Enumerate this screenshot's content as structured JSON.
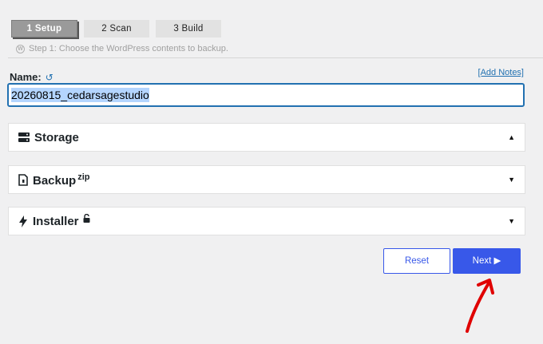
{
  "steps": [
    {
      "label": "1 Setup",
      "active": true
    },
    {
      "label": "2 Scan",
      "active": false
    },
    {
      "label": "3 Build",
      "active": false
    }
  ],
  "step_caption": "Step 1: Choose the WordPress contents to backup.",
  "name": {
    "label": "Name:",
    "add_notes": "[Add Notes]",
    "value": "20260815_cedarsagestudio"
  },
  "panels": {
    "storage": {
      "title": "Storage",
      "icon": "storage-icon",
      "state": "expanded"
    },
    "backup": {
      "title": "Backup",
      "suffix": "zip",
      "icon": "archive-icon",
      "state": "collapsed"
    },
    "installer": {
      "title": "Installer",
      "icon": "bolt-icon",
      "state": "collapsed",
      "lock_icon": "unlock-icon"
    }
  },
  "buttons": {
    "reset": "Reset",
    "next": "Next ▶"
  },
  "colors": {
    "accent": "#3858e9",
    "link": "#2271b1",
    "annotation": "#e00000"
  }
}
